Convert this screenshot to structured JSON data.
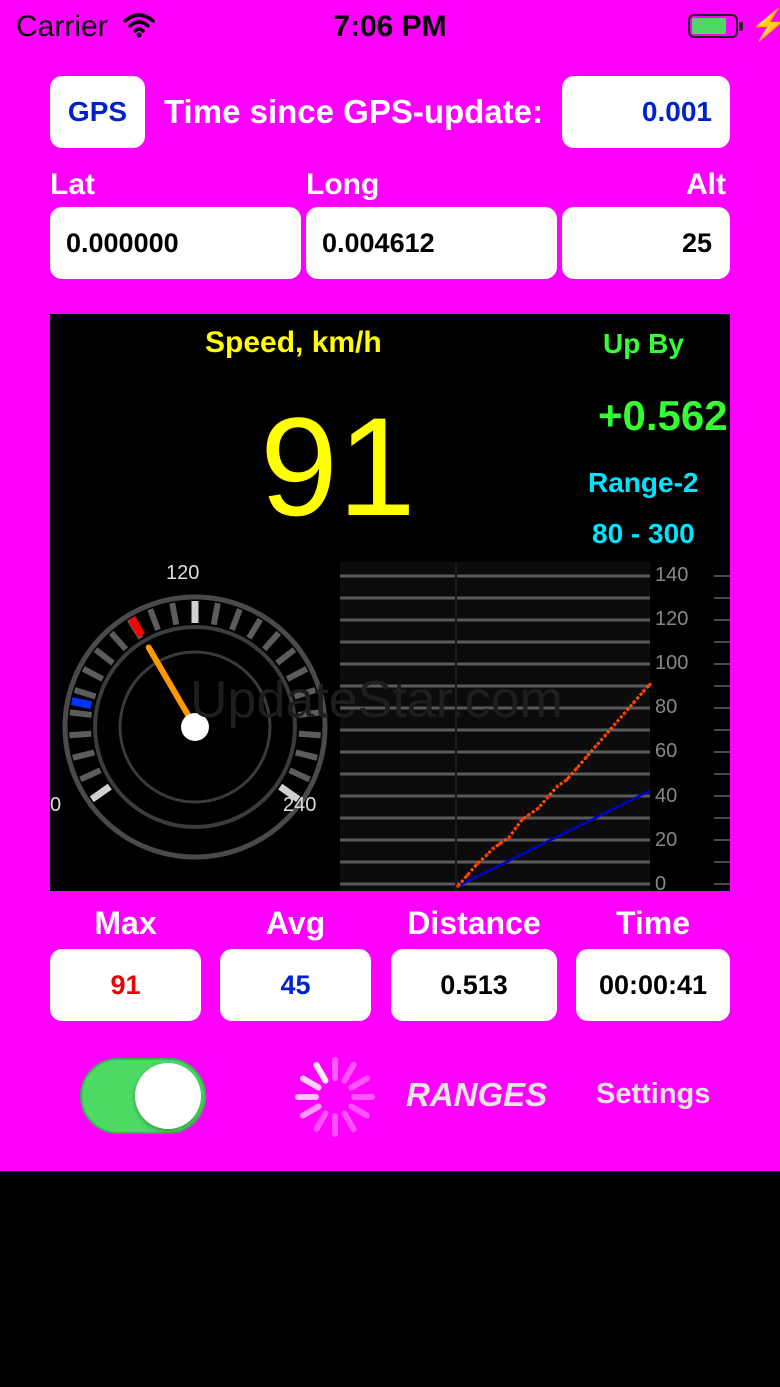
{
  "status_bar": {
    "carrier": "Carrier",
    "time": "7:06 PM",
    "battery_level": 0.75
  },
  "gps": {
    "button_label": "GPS",
    "time_since_label": "Time since GPS-update:",
    "time_since_value": "0.001"
  },
  "position": {
    "lat_label": "Lat",
    "lat_value": "0.000000",
    "long_label": "Long",
    "long_value": "0.004612",
    "alt_label": "Alt",
    "alt_value": "25"
  },
  "speed_panel": {
    "title": "Speed, km/h",
    "speed_value": "91",
    "up_by_label": "Up By",
    "up_by_value": "+0.562",
    "range_label": "Range-2",
    "range_value": "80 - 300",
    "watermark": "UpdateStar.com"
  },
  "gauge": {
    "labels": [
      "120",
      "0",
      "240"
    ],
    "min": 0,
    "max": 240,
    "needle_value": 91,
    "red_marker_value": 91,
    "blue_marker_value": 45,
    "colors": {
      "needle": "#ff9900",
      "red_marker": "#ff0000",
      "blue_marker": "#0033ff"
    }
  },
  "chart_data": {
    "type": "line",
    "y_ticks": [
      "140",
      "120",
      "100",
      "80",
      "60",
      "40",
      "20",
      "0"
    ],
    "ylim": [
      0,
      140
    ],
    "grid": true,
    "series": [
      {
        "color": "#ff5500",
        "points": [
          [
            0,
            0
          ],
          [
            3,
            5
          ],
          [
            6,
            10
          ],
          [
            9,
            14
          ],
          [
            11,
            17
          ],
          [
            13,
            19
          ],
          [
            16,
            22
          ],
          [
            18,
            26
          ],
          [
            20,
            30
          ],
          [
            22,
            32
          ],
          [
            25,
            35
          ],
          [
            28,
            40
          ],
          [
            31,
            45
          ],
          [
            34,
            48
          ],
          [
            37,
            53
          ],
          [
            40,
            58
          ],
          [
            43,
            63
          ],
          [
            46,
            68
          ],
          [
            49,
            73
          ],
          [
            52,
            78
          ],
          [
            55,
            83
          ],
          [
            58,
            88
          ],
          [
            60,
            91
          ]
        ]
      },
      {
        "color": "#0000cc",
        "points": [
          [
            0,
            0
          ],
          [
            60,
            43
          ]
        ]
      }
    ]
  },
  "stats": {
    "max_label": "Max",
    "max_value": "91",
    "avg_label": "Avg",
    "avg_value": "45",
    "distance_label": "Distance",
    "distance_value": "0.513",
    "time_label": "Time",
    "time_value": "00:00:41"
  },
  "controls": {
    "toggle_on": true,
    "ranges_label": "RANGES",
    "settings_label": "Settings"
  }
}
